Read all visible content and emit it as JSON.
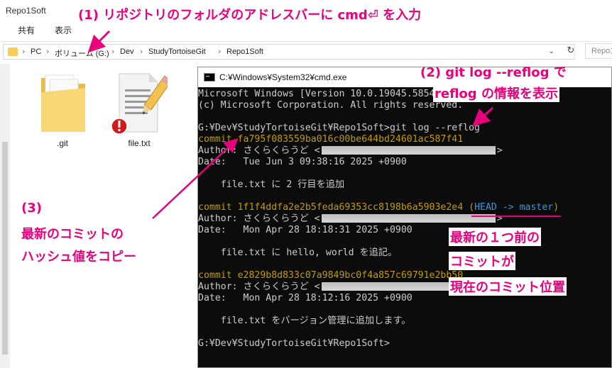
{
  "explorer": {
    "title": "Repo1Soft",
    "ribbon": {
      "share": "共有",
      "view": "表示"
    },
    "breadcrumb": [
      "PC",
      "ボリューム (G:)",
      "Dev",
      "StudyTortoiseGit",
      "Repo1Soft"
    ],
    "search_placeholder": "Repo1",
    "files": [
      {
        "name": ".git",
        "icon": "folder-icon"
      },
      {
        "name": "file.txt",
        "icon": "text-file-icon"
      }
    ]
  },
  "cmd": {
    "title": "C:¥Windows¥System32¥cmd.exe",
    "lines": {
      "l1": "Microsoft Windows [Version 10.0.19045.5854]",
      "l2": "(c) Microsoft Corporation. All rights reserved.",
      "l3": "G:¥Dev¥StudyTortoiseGit¥Repo1Soft>git log --reflog",
      "c1": "commit fa795f083559ba016c00be644bd24601ac587f41",
      "c1_author": "Author: さくらくらうど <",
      "c1_date": "Date:   Tue Jun 3 09:38:16 2025 +0900",
      "c1_msg": "    file.txt に 2 行目を追加",
      "c2": "commit 1f1f4ddfa2e2b5feda69353cc8198b6a5903e2e4",
      "c2_open": " (",
      "c2_head": "HEAD -> master",
      "c2_close": ")",
      "c2_author": "Author: さくらくらうど <",
      "c2_date": "Date:   Mon Apr 28 18:18:31 2025 +0900",
      "c2_msg": "    file.txt に hello, world を追記。",
      "c3": "commit e2829b8d833c07a9849bc0f4a857c69791e2bb50",
      "c3_author": "Author: さくらくらうど <",
      "c3_date": "Date:   Mon Apr 28 18:12:16 2025 +0900",
      "c3_msg": "    file.txt をバージョン管理に追加します。",
      "prompt": "G:¥Dev¥StudyTortoiseGit¥Repo1Soft>",
      "close_angle": ">"
    }
  },
  "annotations": {
    "step1": "(1) リポジトリのフォルダのアドレスバーに cmd⏎ を入力",
    "step2a": "(2) git log --reflog で",
    "step2b": "reflog の情報を表示",
    "step3_num": "(3)",
    "step3a": "最新のコミットの",
    "step3b": "ハッシュ値をコピー",
    "step4a": "最新の１つ前の",
    "step4b": "コミットが",
    "step4c": "現在のコミット位置"
  },
  "colors": {
    "accent": "#e8007d",
    "console_bg": "#0c0c0c",
    "commit_yellow": "#c19c00",
    "head_cyan": "#3a96dd",
    "master_green": "#13a10e"
  }
}
